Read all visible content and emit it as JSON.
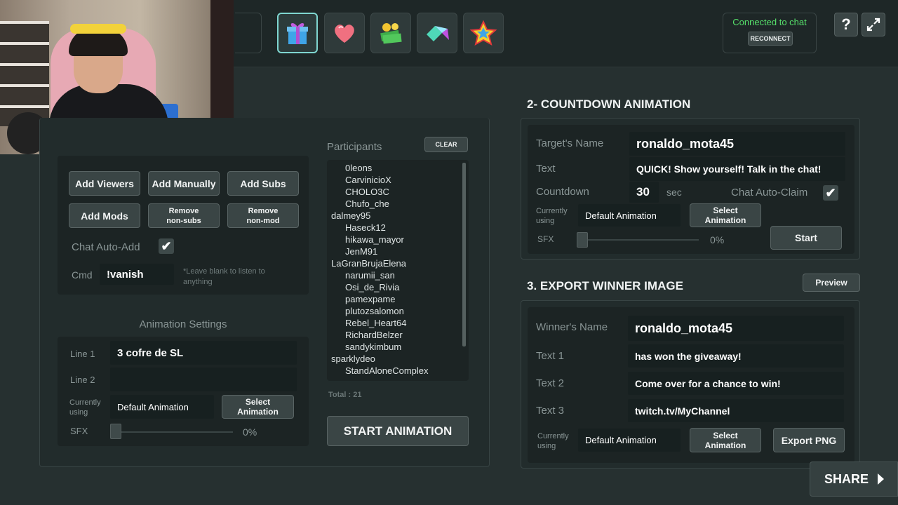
{
  "toolbar": {
    "icons": [
      "gift-icon",
      "heart-icon",
      "money-icon",
      "gem-icon",
      "star-icon"
    ],
    "status": "Connected to chat",
    "reconnect_label": "RECONNECT",
    "help_label": "?"
  },
  "participants": {
    "title": "Participants",
    "clear_label": "CLEAR",
    "items": [
      {
        "name": "0leons",
        "indent": true
      },
      {
        "name": "CarvinicioX",
        "indent": true
      },
      {
        "name": "CHOLO3C",
        "indent": true
      },
      {
        "name": "Chufo_che",
        "indent": true
      },
      {
        "name": "dalmey95",
        "indent": false
      },
      {
        "name": "Haseck12",
        "indent": true
      },
      {
        "name": "hikawa_mayor",
        "indent": true
      },
      {
        "name": "JenM91",
        "indent": true
      },
      {
        "name": "LaGranBrujaElena",
        "indent": false
      },
      {
        "name": "narumii_san",
        "indent": true
      },
      {
        "name": "Osi_de_Rivia",
        "indent": true
      },
      {
        "name": "pamexpame",
        "indent": true
      },
      {
        "name": "plutozsalomon",
        "indent": true
      },
      {
        "name": "Rebel_Heart64",
        "indent": true
      },
      {
        "name": "RichardBelzer",
        "indent": true
      },
      {
        "name": "sandykimbum",
        "indent": true
      },
      {
        "name": "sparklydeo",
        "indent": false
      },
      {
        "name": "StandAloneComplex",
        "indent": true
      }
    ],
    "total": "Total : 21"
  },
  "giveaway": {
    "add_viewers": "Add Viewers",
    "add_manually": "Add Manually",
    "add_subs": "Add Subs",
    "add_mods": "Add Mods",
    "remove_nonsubs": "Remove non-subs",
    "remove_nonmod": "Remove non-mod",
    "chat_auto_add": "Chat Auto-Add",
    "cmd_label": "Cmd",
    "cmd_value": "!vanish",
    "cmd_hint": "*Leave blank to listen to anything"
  },
  "animation_settings": {
    "title": "Animation Settings",
    "line1_label": "Line 1",
    "line1_value": "3 cofre de SL",
    "line2_label": "Line 2",
    "line2_value": "",
    "currently_using_label": "Currently using",
    "animation_name": "Default Animation",
    "select_animation": "Select Animation",
    "sfx_label": "SFX",
    "sfx_value": "0%",
    "start_label": "START ANIMATION"
  },
  "countdown": {
    "title": "2- COUNTDOWN ANIMATION",
    "target_label": "Target's Name",
    "target_value": "ronaldo_mota45",
    "text_label": "Text",
    "text_value": "QUICK!  Show yourself!  Talk in the chat!",
    "countdown_label": "Countdown",
    "countdown_value": "30",
    "sec_label": "sec",
    "auto_claim_label": "Chat Auto-Claim",
    "currently_using_label": "Currently using",
    "animation_name": "Default Animation",
    "select_animation": "Select Animation",
    "sfx_label": "SFX",
    "sfx_value": "0%",
    "start_label": "Start"
  },
  "export": {
    "title": "3. EXPORT WINNER IMAGE",
    "preview_label": "Preview",
    "winner_label": "Winner's Name",
    "winner_value": "ronaldo_mota45",
    "text1_label": "Text 1",
    "text1_value": "has won the giveaway!",
    "text2_label": "Text 2",
    "text2_value": "Come over for a chance to win!",
    "text3_label": "Text 3",
    "text3_value": "twitch.tv/MyChannel",
    "currently_using_label": "Currently using",
    "animation_name": "Default Animation",
    "select_animation": "Select Animation",
    "export_label": "Export PNG"
  },
  "share": {
    "label": "SHARE"
  }
}
